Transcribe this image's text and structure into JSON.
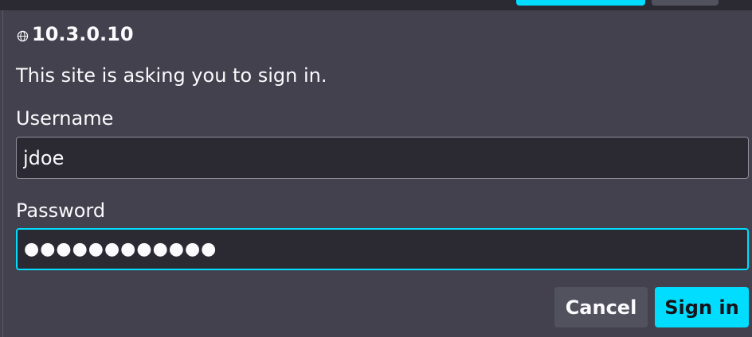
{
  "dialog": {
    "origin_host": "10.3.0.10",
    "origin_icon": "globe-icon",
    "message": "This site is asking you to sign in.",
    "username_label": "Username",
    "username_value": "jdoe",
    "password_label": "Password",
    "password_value": "●●●●●●●●●●●●",
    "cancel_label": "Cancel",
    "signin_label": "Sign in"
  },
  "colors": {
    "accent": "#00ddff",
    "background": "#42414d",
    "field_background": "#2b2a33",
    "secondary_button": "#52515e",
    "text": "#fbfbfe"
  }
}
